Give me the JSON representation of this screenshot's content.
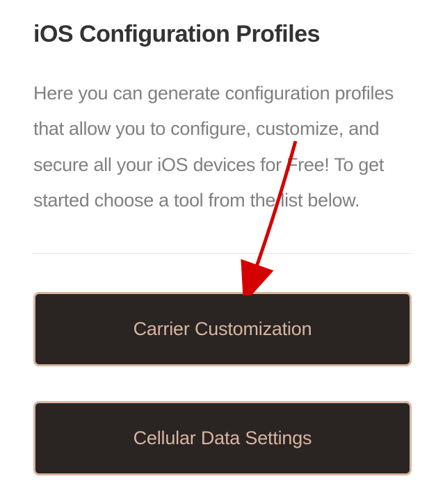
{
  "header": {
    "title": "iOS Configuration Profiles"
  },
  "intro": {
    "text": "Here you can generate configuration profiles that allow you to configure, customize, and secure all your iOS devices for Free! To get started choose a tool from the list below."
  },
  "buttons": {
    "carrier_customization": "Carrier Customization",
    "cellular_data_settings": "Cellular Data Settings"
  },
  "annotation": {
    "arrow_color": "#d40000"
  }
}
